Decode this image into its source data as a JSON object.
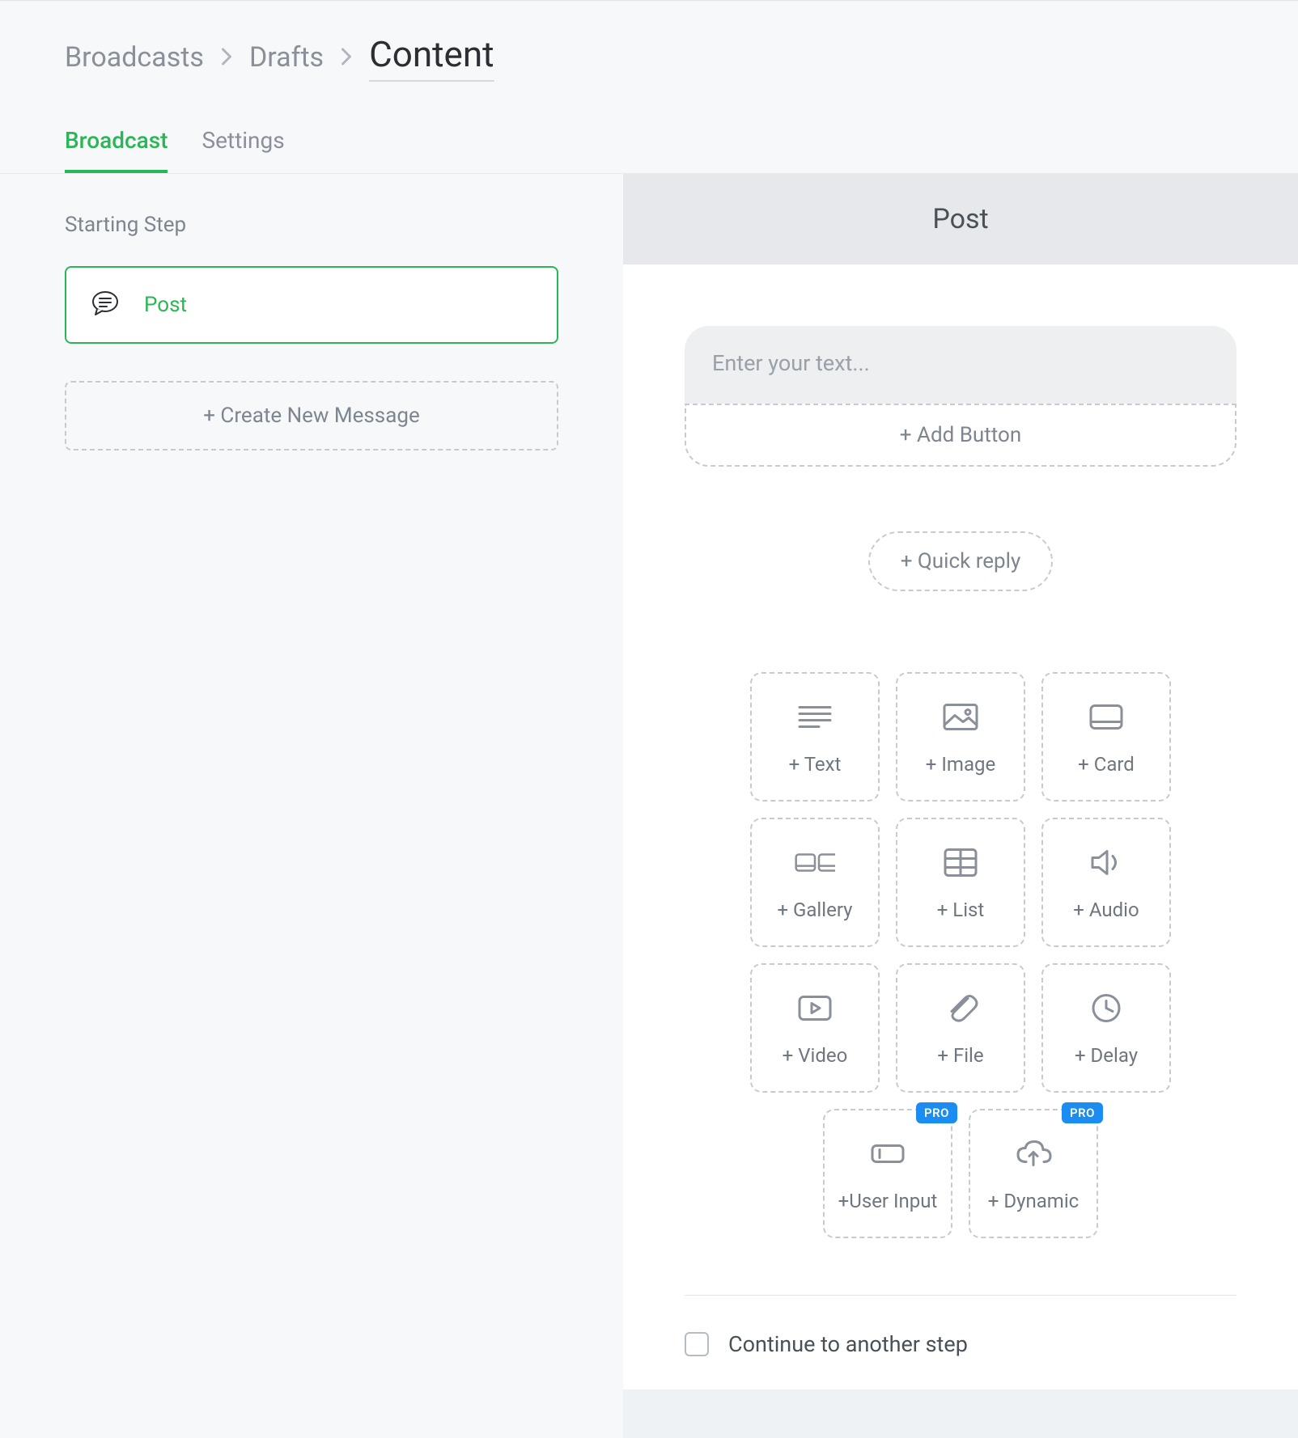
{
  "breadcrumb": {
    "level1": "Broadcasts",
    "level2": "Drafts",
    "current": "Content"
  },
  "tabs": {
    "broadcast": "Broadcast",
    "settings": "Settings"
  },
  "left": {
    "starting_step_label": "Starting Step",
    "step_name": "Post",
    "create_new": "+ Create New Message"
  },
  "panel": {
    "title": "Post",
    "text_placeholder": "Enter your text...",
    "add_button": "+ Add Button",
    "quick_reply": "+ Quick reply",
    "continue_label": "Continue to another step"
  },
  "elements": {
    "text": "+ Text",
    "image": "+ Image",
    "card": "+ Card",
    "gallery": "+ Gallery",
    "list": "+ List",
    "audio": "+ Audio",
    "video": "+ Video",
    "file": "+ File",
    "delay": "+ Delay",
    "user_input": "+User Input",
    "dynamic": "+ Dynamic",
    "pro_badge": "PRO"
  }
}
